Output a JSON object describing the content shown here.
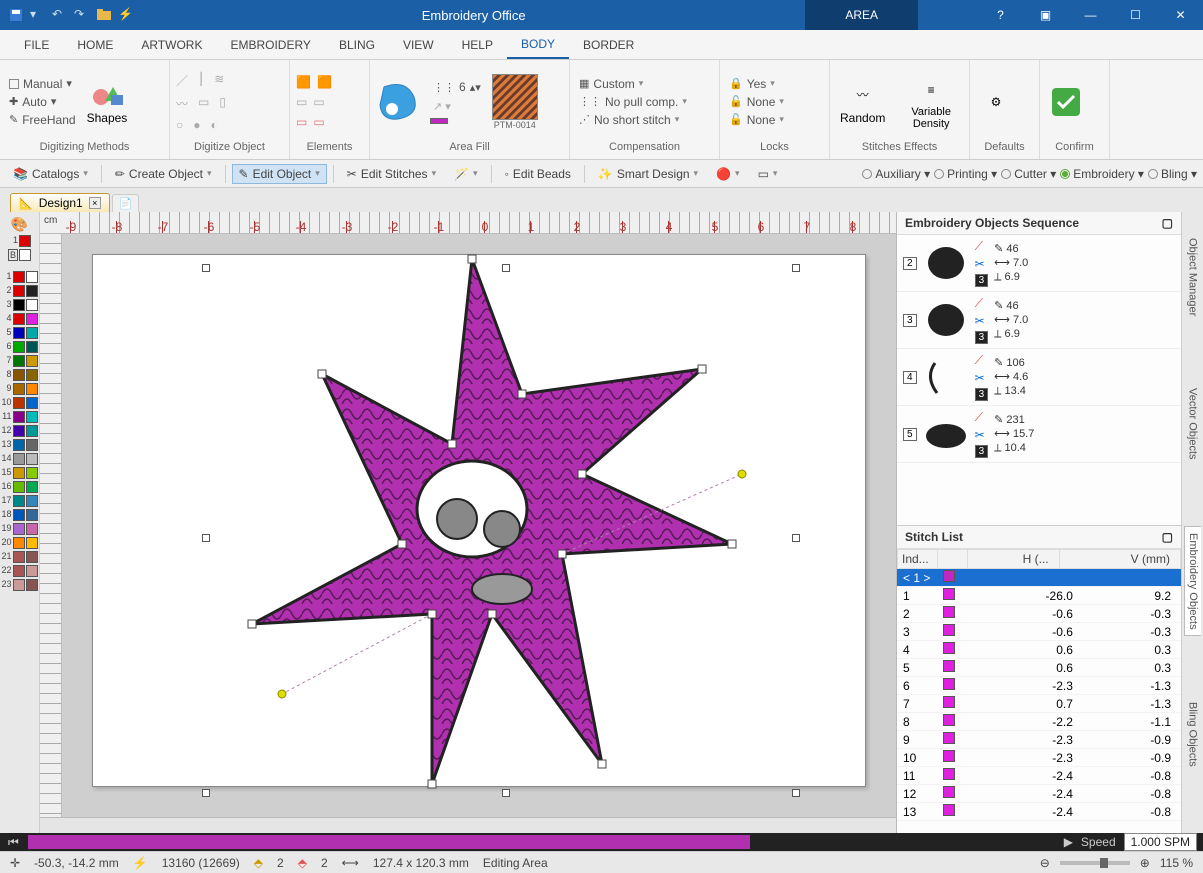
{
  "app_title": "Embroidery Office",
  "context_tab": "AREA",
  "menu_tabs": [
    "FILE",
    "HOME",
    "ARTWORK",
    "EMBROIDERY",
    "BLING",
    "VIEW",
    "HELP",
    "BODY",
    "BORDER"
  ],
  "menu_active": "BODY",
  "ribbon": {
    "digitizing_methods": {
      "label": "Digitizing Methods",
      "manual": "Manual",
      "auto": "Auto",
      "freehand": "FreeHand",
      "shapes": "Shapes"
    },
    "digitize_object": {
      "label": "Digitize Object"
    },
    "elements": {
      "label": "Elements"
    },
    "area_fill": {
      "label": "Area Fill",
      "spin": "6",
      "ptm": "PTM-0014"
    },
    "compensation": {
      "label": "Compensation",
      "custom": "Custom",
      "pull": "No pull comp.",
      "short": "No short stitch"
    },
    "locks": {
      "label": "Locks",
      "yes": "Yes",
      "none1": "None",
      "none2": "None"
    },
    "stitches_effects": {
      "label": "Stitches Effects",
      "random": "Random",
      "density": "Variable Density"
    },
    "defaults": {
      "label": "Defaults"
    },
    "confirm": {
      "label": "Confirm"
    }
  },
  "toolbar2": {
    "catalogs": "Catalogs",
    "create": "Create Object",
    "edit_obj": "Edit Object",
    "edit_st": "Edit Stitches",
    "edit_beads": "Edit Beads",
    "smart": "Smart Design",
    "aux": "Auxiliary",
    "printing": "Printing",
    "cutter": "Cutter",
    "emb": "Embroidery",
    "bling": "Bling"
  },
  "doc_tab": "Design1",
  "ruler_unit": "cm",
  "ruler_h_majors": [
    "-9",
    "-8",
    "-7",
    "-6",
    "-5",
    "-4",
    "-3",
    "-2",
    "-1",
    "0",
    "1",
    "2",
    "3",
    "4",
    "5",
    "6",
    "7",
    "8"
  ],
  "sequence_panel_title": "Embroidery Objects Sequence",
  "sequence": [
    {
      "idx": "2",
      "c": "3",
      "st": "46",
      "w": "7.0",
      "h": "6.9",
      "thumb": "circle-fill"
    },
    {
      "idx": "3",
      "c": "3",
      "st": "46",
      "w": "7.0",
      "h": "6.9",
      "thumb": "circle-fill"
    },
    {
      "idx": "4",
      "c": "3",
      "st": "106",
      "w": "4.6",
      "h": "13.4",
      "thumb": "arc"
    },
    {
      "idx": "5",
      "c": "3",
      "st": "231",
      "w": "15.7",
      "h": "10.4",
      "thumb": "ellipse-fill"
    }
  ],
  "stitch_panel_title": "Stitch List",
  "stitch_headers": {
    "ind": "Ind...",
    "h": "H (...",
    "v": "V (mm)"
  },
  "stitch_rows": [
    {
      "i": "< 1 >",
      "h": "",
      "v": "",
      "sel": true,
      "c": "#c028c0"
    },
    {
      "i": "1",
      "h": "-26.0",
      "v": "9.2",
      "c": "#e020e0"
    },
    {
      "i": "2",
      "h": "-0.6",
      "v": "-0.3",
      "c": "#e020e0"
    },
    {
      "i": "3",
      "h": "-0.6",
      "v": "-0.3",
      "c": "#e020e0"
    },
    {
      "i": "4",
      "h": "0.6",
      "v": "0.3",
      "c": "#e020e0"
    },
    {
      "i": "5",
      "h": "0.6",
      "v": "0.3",
      "c": "#e020e0"
    },
    {
      "i": "6",
      "h": "-2.3",
      "v": "-1.3",
      "c": "#e020e0"
    },
    {
      "i": "7",
      "h": "0.7",
      "v": "-1.3",
      "c": "#e020e0"
    },
    {
      "i": "8",
      "h": "-2.2",
      "v": "-1.1",
      "c": "#e020e0"
    },
    {
      "i": "9",
      "h": "-2.3",
      "v": "-0.9",
      "c": "#e020e0"
    },
    {
      "i": "10",
      "h": "-2.3",
      "v": "-0.9",
      "c": "#e020e0"
    },
    {
      "i": "11",
      "h": "-2.4",
      "v": "-0.8",
      "c": "#e020e0"
    },
    {
      "i": "12",
      "h": "-2.4",
      "v": "-0.8",
      "c": "#e020e0"
    },
    {
      "i": "13",
      "h": "-2.4",
      "v": "-0.8",
      "c": "#e020e0"
    }
  ],
  "rtabs": [
    "Object Manager",
    "Vector Objects",
    "Embroidery Objects",
    "Bling Objects"
  ],
  "rtab_active": "Embroidery Objects",
  "palette": [
    [
      "#d00",
      "#fff"
    ],
    [
      "#d00",
      "#222"
    ],
    [
      "#000",
      "#fff"
    ],
    [
      "#d00",
      "#e020e0"
    ],
    [
      "#00b",
      "#0aa"
    ],
    [
      "#0a0",
      "#055"
    ],
    [
      "#070",
      "#c90"
    ],
    [
      "#850",
      "#860"
    ],
    [
      "#a60",
      "#f80"
    ],
    [
      "#b30",
      "#06c"
    ],
    [
      "#808",
      "#0bb"
    ],
    [
      "#40a",
      "#099"
    ],
    [
      "#06a",
      "#666"
    ],
    [
      "#999",
      "#bbb"
    ],
    [
      "#c90",
      "#8c0"
    ],
    [
      "#6b0",
      "#0a5"
    ],
    [
      "#088",
      "#38b"
    ],
    [
      "#05b",
      "#369"
    ],
    [
      "#a6c",
      "#c6a"
    ],
    [
      "#f80",
      "#fb0"
    ],
    [
      "#a55",
      "#855"
    ],
    [
      "#a55",
      "#c99"
    ],
    [
      "#c99",
      "#855"
    ]
  ],
  "progress": {
    "speed_label": "Speed",
    "speed_value": "1.000 SPM"
  },
  "status": {
    "coords": "-50.3, -14.2 mm",
    "stitches": "13160 (12669)",
    "needle": "2",
    "sel": "2",
    "size": "127.4 x 120.3 mm",
    "mode": "Editing Area",
    "zoom": "115 %"
  }
}
